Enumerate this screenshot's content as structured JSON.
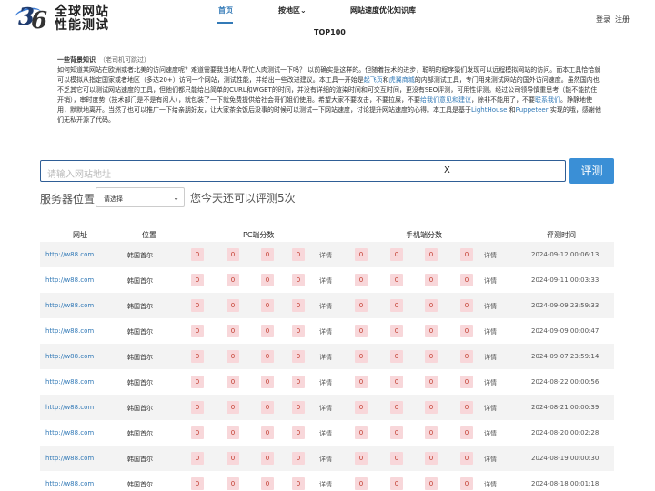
{
  "logo": {
    "line1": "全球网站",
    "line2": "性能测试",
    "mark3": "3",
    "mark6": "6"
  },
  "nav": {
    "home": "首页",
    "region": "按地区",
    "region_caret": "⌄",
    "knowledge": "网站速度优化知识库",
    "top100": "TOP100",
    "login": "登录",
    "register": "注册"
  },
  "intro": {
    "title": "一些背景知识",
    "subtitle": "（老司机可跳过）",
    "p1": "如何知道某网站在欧洲或者北美的访问速度呢？难道需要我当地人帮忙人肉测试一下吗？ 以前确实是这样的。但随着技术的进步，聪明的程序猿们发现可以远程模拟网站的访问。而本工具恰恰就可以模拟从指定国家或者地区（多达20+）访问一个网站，测试性能，并给出一些改进建议。本工具一开始是",
    "link1": "起飞页",
    "p2": "和",
    "link2": "虎翼商城",
    "p3": "的内部测试工具，专门用来测试网站的国外访问速度。虽然国内也不乏其它可以测试网站速度的工具，但他们都只能给出简单的CURL和WGET的时间，并没有详细的渲染时间和可交互时间，更没有SEO评测，可用性评测。经过公司领导慎重思考（能不能抗住开销），审时度势（技术部门是不是有闲人），就包装了一下就免费提供给社会哥们姐们使用。希望大家不要攻击，不要拉屎，不要",
    "link3": "给我们意见和建议",
    "p4": "，除非不能用了，不要",
    "link4": "联系我们",
    "p5": "。静静地使用，默默地离开。当然了也可以推广一下给亲朋好友，让大家茶余饭后没事的时候可以测试一下网站速度，讨论提升网站速度的心得。本工具是基于",
    "link5": "LightHouse",
    "p6": " 和",
    "link6": "Puppeteer",
    "p7": " 实现的哦，感谢他们无私开源了代码。"
  },
  "search": {
    "placeholder": "请输入网站地址",
    "clear": "X",
    "button": "评测"
  },
  "server": {
    "label": "服务器位置",
    "selected": "请选择",
    "quota": "您今天还可以评测5次"
  },
  "table": {
    "headers": {
      "site": "网址",
      "location": "位置",
      "pc": "PC端分数",
      "mobile": "手机端分数",
      "time": "评测时间"
    },
    "rows": [
      {
        "url": "http://w88.com",
        "location": "韩国首尔",
        "pc": [
          "0",
          "0",
          "0",
          "0"
        ],
        "pc_detail": "详情",
        "mobile": [
          "0",
          "0",
          "0",
          "0"
        ],
        "mobile_detail": "详情",
        "time": "2024-09-12 00:06:13"
      },
      {
        "url": "http://w88.com",
        "location": "韩国首尔",
        "pc": [
          "0",
          "0",
          "0",
          "0"
        ],
        "pc_detail": "详情",
        "mobile": [
          "0",
          "0",
          "0",
          "0"
        ],
        "mobile_detail": "详情",
        "time": "2024-09-11 00:03:33"
      },
      {
        "url": "http://w88.com",
        "location": "韩国首尔",
        "pc": [
          "0",
          "0",
          "0",
          "0"
        ],
        "pc_detail": "详情",
        "mobile": [
          "0",
          "0",
          "0",
          "0"
        ],
        "mobile_detail": "详情",
        "time": "2024-09-09 23:59:33"
      },
      {
        "url": "http://w88.com",
        "location": "韩国首尔",
        "pc": [
          "0",
          "0",
          "0",
          "0"
        ],
        "pc_detail": "详情",
        "mobile": [
          "0",
          "0",
          "0",
          "0"
        ],
        "mobile_detail": "详情",
        "time": "2024-09-09 00:00:47"
      },
      {
        "url": "http://w88.com",
        "location": "韩国首尔",
        "pc": [
          "0",
          "0",
          "0",
          "0"
        ],
        "pc_detail": "详情",
        "mobile": [
          "0",
          "0",
          "0",
          "0"
        ],
        "mobile_detail": "详情",
        "time": "2024-09-07 23:59:14"
      },
      {
        "url": "http://w88.com",
        "location": "韩国首尔",
        "pc": [
          "0",
          "0",
          "0",
          "0"
        ],
        "pc_detail": "详情",
        "mobile": [
          "0",
          "0",
          "0",
          "0"
        ],
        "mobile_detail": "详情",
        "time": "2024-08-22 00:00:56"
      },
      {
        "url": "http://w88.com",
        "location": "韩国首尔",
        "pc": [
          "0",
          "0",
          "0",
          "0"
        ],
        "pc_detail": "详情",
        "mobile": [
          "0",
          "0",
          "0",
          "0"
        ],
        "mobile_detail": "详情",
        "time": "2024-08-21 00:00:39"
      },
      {
        "url": "http://w88.com",
        "location": "韩国首尔",
        "pc": [
          "0",
          "0",
          "0",
          "0"
        ],
        "pc_detail": "详情",
        "mobile": [
          "0",
          "0",
          "0",
          "0"
        ],
        "mobile_detail": "详情",
        "time": "2024-08-20 00:02:28"
      },
      {
        "url": "http://w88.com",
        "location": "韩国首尔",
        "pc": [
          "0",
          "0",
          "0",
          "0"
        ],
        "pc_detail": "详情",
        "mobile": [
          "0",
          "0",
          "0",
          "0"
        ],
        "mobile_detail": "详情",
        "time": "2024-08-19 00:00:30"
      },
      {
        "url": "http://w88.com",
        "location": "韩国首尔",
        "pc": [
          "0",
          "0",
          "0",
          "0"
        ],
        "pc_detail": "详情",
        "mobile": [
          "0",
          "0",
          "0",
          "0"
        ],
        "mobile_detail": "详情",
        "time": "2024-08-18 00:01:18"
      }
    ]
  },
  "colors": {
    "accent": "#337ab7",
    "button": "#3a8fd6",
    "score_bg": "#f8d7da",
    "score_text": "#c0392b"
  }
}
